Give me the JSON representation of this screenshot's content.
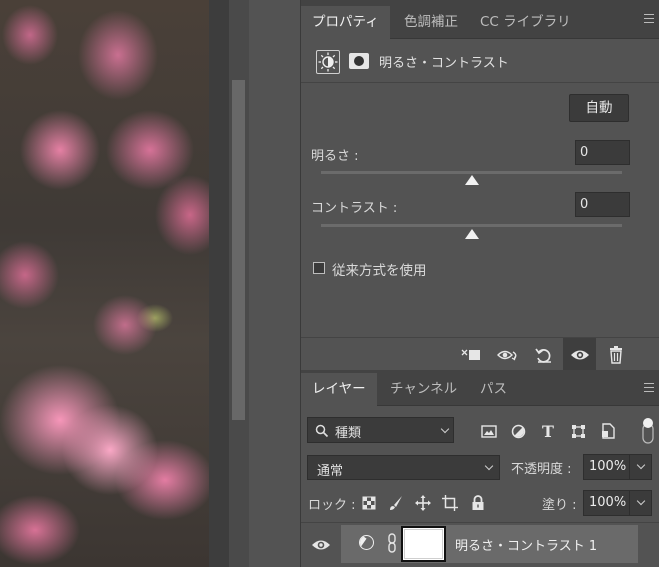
{
  "properties_panel": {
    "tabs": [
      {
        "label": "プロパティ",
        "active": true
      },
      {
        "label": "色調補正",
        "active": false
      },
      {
        "label": "CC ライブラリ",
        "active": false
      }
    ],
    "adjustment_title": "明るさ・コントラスト",
    "auto_button": "自動",
    "brightness": {
      "label": "明るさ :",
      "value": "0",
      "slider_fraction": 0.5
    },
    "contrast": {
      "label": "コントラスト :",
      "value": "0",
      "slider_fraction": 0.5
    },
    "legacy_checkbox": {
      "label": "従来方式を使用",
      "checked": false
    },
    "footer_icons": [
      "clip-to-layer-icon",
      "view-previous-state-icon",
      "reset-icon",
      "visibility-icon",
      "trash-icon"
    ]
  },
  "layers_panel": {
    "tabs": [
      {
        "label": "レイヤー",
        "active": true
      },
      {
        "label": "チャンネル",
        "active": false
      },
      {
        "label": "パス",
        "active": false
      }
    ],
    "filter": {
      "value": "種類",
      "icons": [
        "image-filter-icon",
        "adjustment-filter-icon",
        "type-filter-icon",
        "shape-filter-icon",
        "smart-object-filter-icon"
      ]
    },
    "blend_mode": "通常",
    "opacity_label": "不透明度 :",
    "opacity_value": "100%",
    "lock_label": "ロック :",
    "fill_label": "塗り :",
    "fill_value": "100%",
    "layers": [
      {
        "name": "明るさ・コントラスト 1",
        "visible": true,
        "selected": true
      }
    ]
  },
  "colors": {
    "panel_bg": "#535353",
    "tab_bar_bg": "#434343",
    "field_bg": "#3b3b3b",
    "selected_layer": "#6a6a6a"
  }
}
